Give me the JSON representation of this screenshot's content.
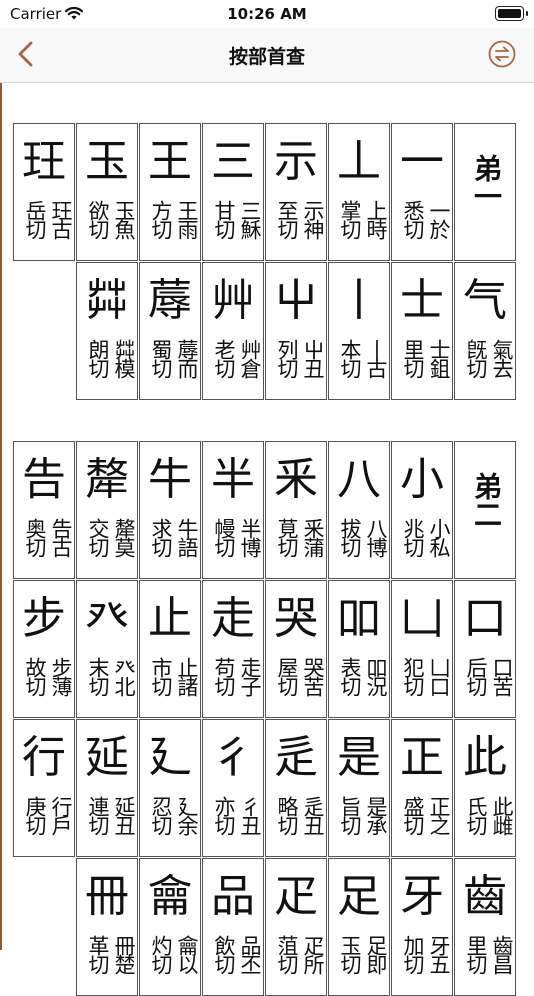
{
  "status_bar": {
    "carrier": "Carrier",
    "time": "10:26 AM"
  },
  "nav": {
    "title": "按部首查"
  },
  "blocks": [
    {
      "label": "弟一",
      "rows": [
        [
          {
            "glyph": "一",
            "left": "悉切",
            "right": "一於"
          },
          {
            "glyph": "丄",
            "left": "掌切",
            "right": "上時"
          },
          {
            "glyph": "示",
            "left": "至切",
            "right": "示神"
          },
          {
            "glyph": "三",
            "left": "甘切",
            "right": "三穌"
          },
          {
            "glyph": "王",
            "left": "方切",
            "right": "王雨"
          },
          {
            "glyph": "玉",
            "left": "欲切",
            "right": "玉魚"
          },
          {
            "glyph": "玨",
            "left": "岳切",
            "right": "玨古"
          }
        ],
        [
          {
            "glyph": "气",
            "left": "旣切",
            "right": "氣去"
          },
          {
            "glyph": "士",
            "left": "里切",
            "right": "士鉏"
          },
          {
            "glyph": "丨",
            "left": "本切",
            "right": "丨古"
          },
          {
            "glyph": "屮",
            "left": "列切",
            "right": "屮丑"
          },
          {
            "glyph": "艸",
            "left": "老切",
            "right": "艸倉"
          },
          {
            "glyph": "蓐",
            "left": "蜀切",
            "right": "蓐而"
          },
          {
            "glyph": "茻",
            "left": "朗切",
            "right": "茻模"
          }
        ]
      ]
    },
    {
      "label": "弟二",
      "rows": [
        [
          {
            "glyph": "小",
            "left": "兆切",
            "right": "小私"
          },
          {
            "glyph": "八",
            "left": "拔切",
            "right": "八博"
          },
          {
            "glyph": "釆",
            "left": "莧切",
            "right": "釆蒲"
          },
          {
            "glyph": "半",
            "left": "幔切",
            "right": "半博"
          },
          {
            "glyph": "牛",
            "left": "求切",
            "right": "牛語"
          },
          {
            "glyph": "犛",
            "left": "交切",
            "right": "犛莫"
          },
          {
            "glyph": "告",
            "left": "奥切",
            "right": "告古"
          }
        ],
        [
          {
            "glyph": "口",
            "left": "后切",
            "right": "口苦"
          },
          {
            "glyph": "凵",
            "left": "犯切",
            "right": "凵口"
          },
          {
            "glyph": "吅",
            "left": "表切",
            "right": "吅況"
          },
          {
            "glyph": "哭",
            "left": "屋切",
            "right": "哭苦"
          },
          {
            "glyph": "走",
            "left": "苟切",
            "right": "走子"
          },
          {
            "glyph": "止",
            "left": "市切",
            "right": "止諸"
          },
          {
            "glyph": "癶",
            "left": "末切",
            "right": "癶北"
          },
          {
            "glyph": "步",
            "left": "故切",
            "right": "步薄"
          }
        ],
        [
          {
            "glyph": "此",
            "left": "氏切",
            "right": "此雌"
          },
          {
            "glyph": "正",
            "left": "盛切",
            "right": "正之"
          },
          {
            "glyph": "是",
            "left": "旨切",
            "right": "是承"
          },
          {
            "glyph": "辵",
            "left": "略切",
            "right": "辵丑"
          },
          {
            "glyph": "彳",
            "left": "亦切",
            "right": "彳丑"
          },
          {
            "glyph": "廴",
            "left": "忍切",
            "right": "廴余"
          },
          {
            "glyph": "延",
            "left": "連切",
            "right": "延丑"
          },
          {
            "glyph": "行",
            "left": "庚切",
            "right": "行戶"
          }
        ],
        [
          {
            "glyph": "齒",
            "left": "里切",
            "right": "齒昌"
          },
          {
            "glyph": "牙",
            "left": "加切",
            "right": "牙五"
          },
          {
            "glyph": "足",
            "left": "玉切",
            "right": "足即"
          },
          {
            "glyph": "疋",
            "left": "菹切",
            "right": "疋所"
          },
          {
            "glyph": "品",
            "left": "飲切",
            "right": "品丕"
          },
          {
            "glyph": "龠",
            "left": "灼切",
            "right": "龠以"
          },
          {
            "glyph": "冊",
            "left": "革切",
            "right": "冊楚"
          }
        ]
      ]
    }
  ]
}
